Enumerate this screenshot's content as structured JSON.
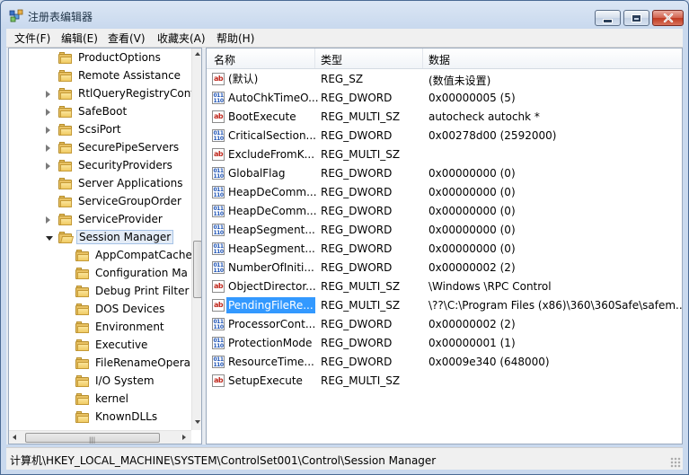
{
  "window": {
    "title": "注册表编辑器"
  },
  "menu": [
    "文件(F)",
    "编辑(E)",
    "查看(V)",
    "收藏夹(A)",
    "帮助(H)"
  ],
  "tree": [
    {
      "label": "ProductOptions",
      "expander": "none"
    },
    {
      "label": "Remote Assistance",
      "expander": "none"
    },
    {
      "label": "RtlQueryRegistryConf",
      "expander": "collapsed"
    },
    {
      "label": "SafeBoot",
      "expander": "collapsed"
    },
    {
      "label": "ScsiPort",
      "expander": "collapsed"
    },
    {
      "label": "SecurePipeServers",
      "expander": "collapsed"
    },
    {
      "label": "SecurityProviders",
      "expander": "collapsed"
    },
    {
      "label": "Server Applications",
      "expander": "none"
    },
    {
      "label": "ServiceGroupOrder",
      "expander": "none"
    },
    {
      "label": "ServiceProvider",
      "expander": "collapsed"
    },
    {
      "label": "Session Manager",
      "expander": "open",
      "selected": true
    },
    {
      "label": "AppCompatCache",
      "expander": "none",
      "child": true
    },
    {
      "label": "Configuration Ma",
      "expander": "none",
      "child": true
    },
    {
      "label": "Debug Print Filter",
      "expander": "none",
      "child": true
    },
    {
      "label": "DOS Devices",
      "expander": "none",
      "child": true
    },
    {
      "label": "Environment",
      "expander": "none",
      "child": true
    },
    {
      "label": "Executive",
      "expander": "none",
      "child": true
    },
    {
      "label": "FileRenameOpera",
      "expander": "none",
      "child": true
    },
    {
      "label": "I/O System",
      "expander": "none",
      "child": true
    },
    {
      "label": "kernel",
      "expander": "none",
      "child": true
    },
    {
      "label": "KnownDLLs",
      "expander": "none",
      "child": true
    }
  ],
  "columns": {
    "name": "名称",
    "type": "类型",
    "data": "数据"
  },
  "values": [
    {
      "name": "(默认)",
      "type": "REG_SZ",
      "data": "(数值未设置)",
      "icon": "string"
    },
    {
      "name": "AutoChkTimeO...",
      "type": "REG_DWORD",
      "data": "0x00000005 (5)",
      "icon": "binary"
    },
    {
      "name": "BootExecute",
      "type": "REG_MULTI_SZ",
      "data": "autocheck autochk *",
      "icon": "string"
    },
    {
      "name": "CriticalSection...",
      "type": "REG_DWORD",
      "data": "0x00278d00 (2592000)",
      "icon": "binary"
    },
    {
      "name": "ExcludeFromK...",
      "type": "REG_MULTI_SZ",
      "data": "",
      "icon": "string"
    },
    {
      "name": "GlobalFlag",
      "type": "REG_DWORD",
      "data": "0x00000000 (0)",
      "icon": "binary"
    },
    {
      "name": "HeapDeComm...",
      "type": "REG_DWORD",
      "data": "0x00000000 (0)",
      "icon": "binary"
    },
    {
      "name": "HeapDeComm...",
      "type": "REG_DWORD",
      "data": "0x00000000 (0)",
      "icon": "binary"
    },
    {
      "name": "HeapSegment...",
      "type": "REG_DWORD",
      "data": "0x00000000 (0)",
      "icon": "binary"
    },
    {
      "name": "HeapSegment...",
      "type": "REG_DWORD",
      "data": "0x00000000 (0)",
      "icon": "binary"
    },
    {
      "name": "NumberOfIniti...",
      "type": "REG_DWORD",
      "data": "0x00000002 (2)",
      "icon": "binary"
    },
    {
      "name": "ObjectDirector...",
      "type": "REG_MULTI_SZ",
      "data": "\\Windows \\RPC Control",
      "icon": "string"
    },
    {
      "name": "PendingFileRe...",
      "type": "REG_MULTI_SZ",
      "data": "\\??\\C:\\Program Files (x86)\\360\\360Safe\\safem...",
      "icon": "string",
      "selected": true
    },
    {
      "name": "ProcessorCont...",
      "type": "REG_DWORD",
      "data": "0x00000002 (2)",
      "icon": "binary"
    },
    {
      "name": "ProtectionMode",
      "type": "REG_DWORD",
      "data": "0x00000001 (1)",
      "icon": "binary"
    },
    {
      "name": "ResourceTime...",
      "type": "REG_DWORD",
      "data": "0x0009e340 (648000)",
      "icon": "binary"
    },
    {
      "name": "SetupExecute",
      "type": "REG_MULTI_SZ",
      "data": "",
      "icon": "string"
    }
  ],
  "icon_glyphs": {
    "string": "ab",
    "binary": "011\n110"
  },
  "status": {
    "path": "计算机\\HKEY_LOCAL_MACHINE\\SYSTEM\\ControlSet001\\Control\\Session Manager"
  },
  "colors": {
    "selection": "#3399ff",
    "title_text": "#1e3246",
    "close_button": "#c0391f"
  }
}
